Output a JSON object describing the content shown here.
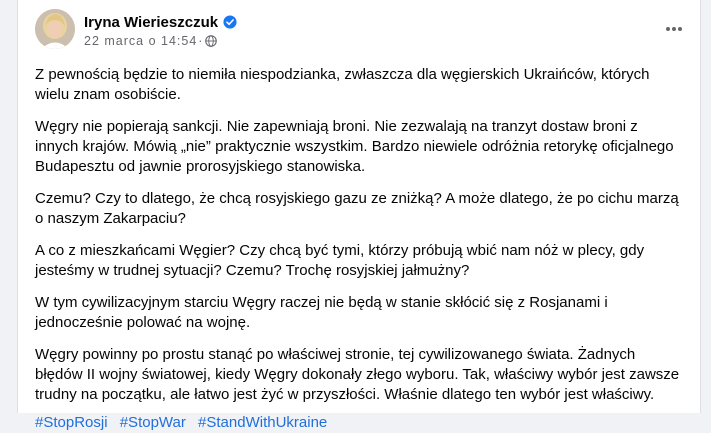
{
  "post": {
    "author": "Iryna Wierieszczuk",
    "date": "22 marca o 14:54",
    "date_sep": "·",
    "paragraphs": [
      "Z pewnością będzie to niemiła niespodzianka, zwłaszcza dla węgierskich Ukraińców, których wielu znam osobiście.",
      "Węgry nie popierają sankcji. Nie zapewniają broni. Nie zezwalają na tranzyt dostaw broni z innych krajów. Mówią „nie” praktycznie wszystkim. Bardzo niewiele odróżnia retorykę oficjalnego Budapesztu od jawnie prorosyjskiego stanowiska.",
      "Czemu? Czy to dlatego, że chcą rosyjskiego gazu ze zniżką? A może dlatego, że po cichu marzą o naszym Zakarpaciu?",
      "A co z mieszkańcami Węgier? Czy chcą być tymi, którzy próbują wbić nam nóż w plecy, gdy jesteśmy w trudnej sytuacji? Czemu? Trochę rosyjskiej jałmużny?",
      "W tym cywilizacyjnym starciu Węgry raczej nie będą w stanie skłócić się z Rosjanami i jednocześnie polować na wojnę.",
      "Węgry powinny po prostu stanąć po właściwej stronie, tej cywilizowanego świata. Żadnych błędów II wojny światowej, kiedy Węgry dokonały złego wyboru. Tak, właściwy wybór jest zawsze trudny na początku, ale łatwo jest żyć w przyszłości. Właśnie dlatego ten wybór jest właściwy."
    ],
    "hashtags": [
      "#StopRosji",
      "#StopWar",
      "#StandWithUkraine"
    ]
  },
  "icons": {
    "verified": "verified-badge-icon",
    "audience": "globe-icon",
    "menu": "more-options-icon"
  },
  "colors": {
    "link": "#216fdb",
    "verified": "#1877f2",
    "meta": "#65676b"
  }
}
